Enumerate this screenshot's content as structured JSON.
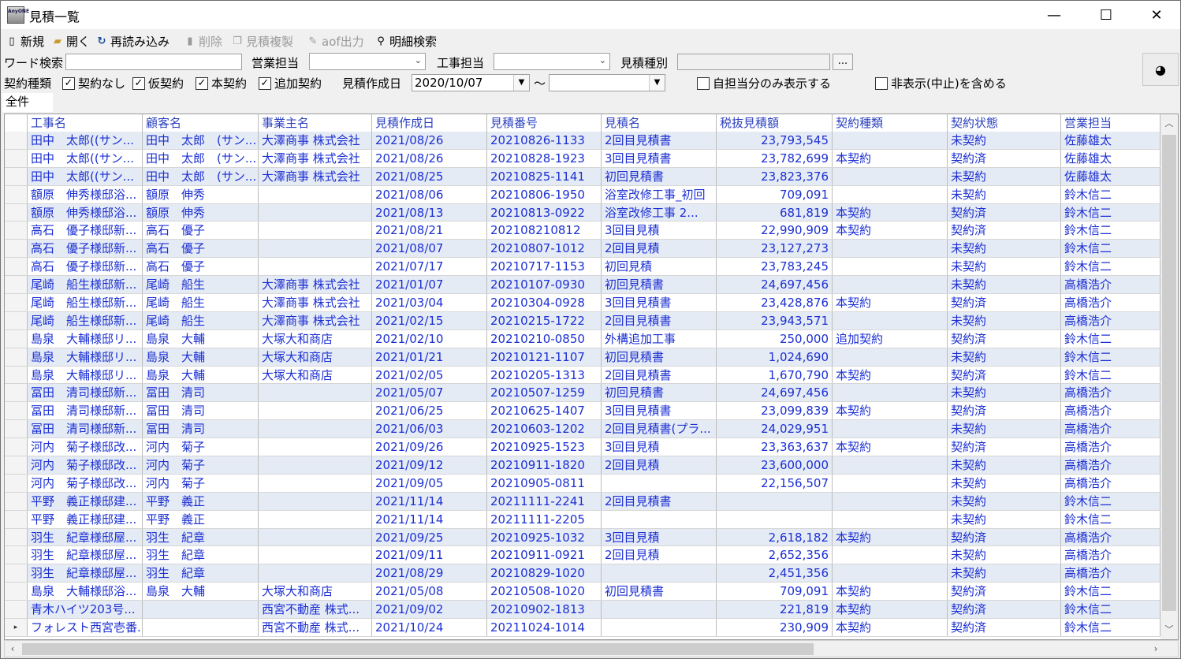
{
  "window": {
    "title": "見積一覧",
    "app_icon_text": "AnyONE",
    "minimize": "—",
    "maximize": "☐",
    "close": "✕"
  },
  "toolbar": {
    "new_label": "新規",
    "open_label": "開く",
    "reload_label": "再読み込み",
    "delete_label": "削除",
    "copy_label": "見積複製",
    "aof_label": "aof出力",
    "detail_search_label": "明細検索"
  },
  "filters": {
    "word_search_label": "ワード検索",
    "word_search_value": "",
    "sales_label": "営業担当",
    "sales_value": "",
    "construction_label": "工事担当",
    "construction_value": "",
    "estimate_type_label": "見積種別",
    "estimate_type_value": "",
    "estimate_type_button": "...",
    "contract_type_label": "契約種類",
    "contract_none": "契約なし",
    "contract_provisional": "仮契約",
    "contract_main": "本契約",
    "contract_additional": "追加契約",
    "created_date_label": "見積作成日",
    "date_from": "2020/10/07",
    "date_to": "",
    "tilde": "〜",
    "only_self_label": "自担当分のみ表示する",
    "include_hidden_label": "非表示(中止)を含める"
  },
  "tab": {
    "label": "全件"
  },
  "grid": {
    "columns": [
      "工事名",
      "顧客名",
      "事業主名",
      "見積作成日",
      "見積番号",
      "見積名",
      "税抜見積額",
      "契約種類",
      "契約状態",
      "営業担当"
    ],
    "rows": [
      [
        "田中　太郎((サン...",
        "田中　太郎　(サン...",
        "大澤商事 株式会社",
        "2021/08/26",
        "20210826-1133",
        "2回目見積書",
        "23,793,545",
        "",
        "未契約",
        "佐藤雄太"
      ],
      [
        "田中　太郎((サン...",
        "田中　太郎　(サン...",
        "大澤商事 株式会社",
        "2021/08/26",
        "20210828-1923",
        "3回目見積書",
        "23,782,699",
        "本契約",
        "契約済",
        "佐藤雄太"
      ],
      [
        "田中　太郎((サン...",
        "田中　太郎　(サン...",
        "大澤商事 株式会社",
        "2021/08/25",
        "20210825-1141",
        "初回見積書",
        "23,823,376",
        "",
        "未契約",
        "佐藤雄太"
      ],
      [
        "額原　伸秀様邸浴...",
        "額原　伸秀",
        "",
        "2021/08/06",
        "20210806-1950",
        "浴室改修工事_初回",
        "709,091",
        "",
        "未契約",
        "鈴木信二"
      ],
      [
        "額原　伸秀様邸浴...",
        "額原　伸秀",
        "",
        "2021/08/13",
        "20210813-0922",
        "浴室改修工事 2...",
        "681,819",
        "本契約",
        "契約済",
        "鈴木信二"
      ],
      [
        "高石　優子様邸新...",
        "高石　優子",
        "",
        "2021/08/21",
        "202108210812",
        "3回目見積",
        "22,990,909",
        "本契約",
        "契約済",
        "鈴木信二"
      ],
      [
        "高石　優子様邸新...",
        "高石　優子",
        "",
        "2021/08/07",
        "20210807-1012",
        "2回目見積",
        "23,127,273",
        "",
        "未契約",
        "鈴木信二"
      ],
      [
        "高石　優子様邸新...",
        "高石　優子",
        "",
        "2021/07/17",
        "20210717-1153",
        "初回見積",
        "23,783,245",
        "",
        "未契約",
        "鈴木信二"
      ],
      [
        "尾崎　船生様邸新...",
        "尾崎　船生",
        "大澤商事 株式会社",
        "2021/01/07",
        "20210107-0930",
        "初回見積書",
        "24,697,456",
        "",
        "未契約",
        "高橋浩介"
      ],
      [
        "尾崎　船生様邸新...",
        "尾崎　船生",
        "大澤商事 株式会社",
        "2021/03/04",
        "20210304-0928",
        "3回目見積書",
        "23,428,876",
        "本契約",
        "契約済",
        "高橋浩介"
      ],
      [
        "尾崎　船生様邸新...",
        "尾崎　船生",
        "大澤商事 株式会社",
        "2021/02/15",
        "20210215-1722",
        "2回目見積書",
        "23,943,571",
        "",
        "未契約",
        "高橋浩介"
      ],
      [
        "島泉　大輔様邸リ...",
        "島泉　大輔",
        "大塚大和商店",
        "2021/02/10",
        "20210210-0850",
        "外構追加工事",
        "250,000",
        "追加契約",
        "契約済",
        "鈴木信二"
      ],
      [
        "島泉　大輔様邸リ...",
        "島泉　大輔",
        "大塚大和商店",
        "2021/01/21",
        "20210121-1107",
        "初回見積書",
        "1,024,690",
        "",
        "未契約",
        "鈴木信二"
      ],
      [
        "島泉　大輔様邸リ...",
        "島泉　大輔",
        "大塚大和商店",
        "2021/02/05",
        "20210205-1313",
        "2回目見積書",
        "1,670,790",
        "本契約",
        "契約済",
        "鈴木信二"
      ],
      [
        "冨田　清司様邸新...",
        "冨田　清司",
        "",
        "2021/05/07",
        "20210507-1259",
        "初回見積書",
        "24,697,456",
        "",
        "未契約",
        "高橋浩介"
      ],
      [
        "冨田　清司様邸新...",
        "冨田　清司",
        "",
        "2021/06/25",
        "20210625-1407",
        "3回目見積書",
        "23,099,839",
        "本契約",
        "契約済",
        "高橋浩介"
      ],
      [
        "冨田　清司様邸新...",
        "冨田　清司",
        "",
        "2021/06/03",
        "20210603-1202",
        "2回目見積書(プラ...",
        "24,029,951",
        "",
        "未契約",
        "高橋浩介"
      ],
      [
        "河内　菊子様邸改...",
        "河内　菊子",
        "",
        "2021/09/26",
        "20210925-1523",
        "3回目見積",
        "23,363,637",
        "本契約",
        "契約済",
        "高橋浩介"
      ],
      [
        "河内　菊子様邸改...",
        "河内　菊子",
        "",
        "2021/09/12",
        "20210911-1820",
        "2回目見積",
        "23,600,000",
        "",
        "未契約",
        "高橋浩介"
      ],
      [
        "河内　菊子様邸改...",
        "河内　菊子",
        "",
        "2021/09/05",
        "20210905-0811",
        "",
        "22,156,507",
        "",
        "未契約",
        "高橋浩介"
      ],
      [
        "平野　義正様邸建...",
        "平野　義正",
        "",
        "2021/11/14",
        "20211111-2241",
        "2回目見積書",
        "",
        "",
        "未契約",
        "鈴木信二"
      ],
      [
        "平野　義正様邸建...",
        "平野　義正",
        "",
        "2021/11/14",
        "20211111-2205",
        "",
        "",
        "",
        "未契約",
        "鈴木信二"
      ],
      [
        "羽生　紀章様邸屋...",
        "羽生　紀章",
        "",
        "2021/09/25",
        "20210925-1032",
        "3回目見積",
        "2,618,182",
        "本契約",
        "契約済",
        "高橋浩介"
      ],
      [
        "羽生　紀章様邸屋...",
        "羽生　紀章",
        "",
        "2021/09/11",
        "20210911-0921",
        "2回目見積",
        "2,652,356",
        "",
        "未契約",
        "高橋浩介"
      ],
      [
        "羽生　紀章様邸屋...",
        "羽生　紀章",
        "",
        "2021/08/29",
        "20210829-1020",
        "",
        "2,451,356",
        "",
        "未契約",
        "高橋浩介"
      ],
      [
        "島泉　大輔様邸浴...",
        "島泉　大輔",
        "大塚大和商店",
        "2021/05/08",
        "20210508-1020",
        "初回見積書",
        "709,091",
        "本契約",
        "契約済",
        "鈴木信二"
      ],
      [
        "青木ハイツ203号...",
        "",
        "西宮不動産 株式...",
        "2021/09/02",
        "20210902-1813",
        "",
        "221,819",
        "本契約",
        "契約済",
        "鈴木信二"
      ],
      [
        "フォレスト西宮壱番...",
        "",
        "西宮不動産 株式...",
        "2021/10/24",
        "20211024-1014",
        "",
        "230,909",
        "本契約",
        "契約済",
        "鈴木信二"
      ]
    ]
  }
}
